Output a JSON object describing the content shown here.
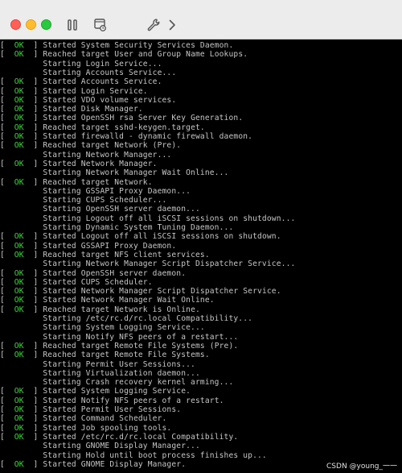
{
  "toolbar": {
    "icons": [
      "pause-icon",
      "snapshot-icon",
      "settings-wrench-icon",
      "forward-chevron-icon"
    ],
    "colors": {
      "close": "#fe5f57",
      "minimize": "#febc2e",
      "zoom": "#28c840"
    }
  },
  "console": {
    "ok_label": "OK",
    "ok_color": "#37d437",
    "lines": [
      {
        "status": "OK",
        "text": "Started System Security Services Daemon."
      },
      {
        "status": "OK",
        "text": "Reached target User and Group Name Lookups."
      },
      {
        "status": "",
        "text": "Starting Login Service..."
      },
      {
        "status": "",
        "text": "Starting Accounts Service..."
      },
      {
        "status": "OK",
        "text": "Started Accounts Service."
      },
      {
        "status": "OK",
        "text": "Started Login Service."
      },
      {
        "status": "OK",
        "text": "Started VDO volume services."
      },
      {
        "status": "OK",
        "text": "Started Disk Manager."
      },
      {
        "status": "OK",
        "text": "Started OpenSSH rsa Server Key Generation."
      },
      {
        "status": "OK",
        "text": "Reached target sshd-keygen.target."
      },
      {
        "status": "OK",
        "text": "Started firewalld - dynamic firewall daemon."
      },
      {
        "status": "OK",
        "text": "Reached target Network (Pre)."
      },
      {
        "status": "",
        "text": "Starting Network Manager..."
      },
      {
        "status": "OK",
        "text": "Started Network Manager."
      },
      {
        "status": "",
        "text": "Starting Network Manager Wait Online..."
      },
      {
        "status": "OK",
        "text": "Reached target Network."
      },
      {
        "status": "",
        "text": "Starting GSSAPI Proxy Daemon..."
      },
      {
        "status": "",
        "text": "Starting CUPS Scheduler..."
      },
      {
        "status": "",
        "text": "Starting OpenSSH server daemon..."
      },
      {
        "status": "",
        "text": "Starting Logout off all iSCSI sessions on shutdown..."
      },
      {
        "status": "",
        "text": "Starting Dynamic System Tuning Daemon..."
      },
      {
        "status": "OK",
        "text": "Started Logout off all iSCSI sessions on shutdown."
      },
      {
        "status": "OK",
        "text": "Started GSSAPI Proxy Daemon."
      },
      {
        "status": "OK",
        "text": "Reached target NFS client services."
      },
      {
        "status": "",
        "text": "Starting Network Manager Script Dispatcher Service..."
      },
      {
        "status": "OK",
        "text": "Started OpenSSH server daemon."
      },
      {
        "status": "OK",
        "text": "Started CUPS Scheduler."
      },
      {
        "status": "OK",
        "text": "Started Network Manager Script Dispatcher Service."
      },
      {
        "status": "OK",
        "text": "Started Network Manager Wait Online."
      },
      {
        "status": "OK",
        "text": "Reached target Network is Online."
      },
      {
        "status": "",
        "text": "Starting /etc/rc.d/rc.local Compatibility..."
      },
      {
        "status": "",
        "text": "Starting System Logging Service..."
      },
      {
        "status": "",
        "text": "Starting Notify NFS peers of a restart..."
      },
      {
        "status": "OK",
        "text": "Reached target Remote File Systems (Pre)."
      },
      {
        "status": "OK",
        "text": "Reached target Remote File Systems."
      },
      {
        "status": "",
        "text": "Starting Permit User Sessions..."
      },
      {
        "status": "",
        "text": "Starting Virtualization daemon..."
      },
      {
        "status": "",
        "text": "Starting Crash recovery kernel arming..."
      },
      {
        "status": "OK",
        "text": "Started System Logging Service."
      },
      {
        "status": "OK",
        "text": "Started Notify NFS peers of a restart."
      },
      {
        "status": "OK",
        "text": "Started Permit User Sessions."
      },
      {
        "status": "OK",
        "text": "Started Command Scheduler."
      },
      {
        "status": "OK",
        "text": "Started Job spooling tools."
      },
      {
        "status": "OK",
        "text": "Started /etc/rc.d/rc.local Compatibility."
      },
      {
        "status": "",
        "text": "Starting GNOME Display Manager..."
      },
      {
        "status": "",
        "text": "Starting Hold until boot process finishes up..."
      },
      {
        "status": "OK",
        "text": "Started GNOME Display Manager."
      }
    ]
  },
  "watermark": "CSDN @young_一一"
}
